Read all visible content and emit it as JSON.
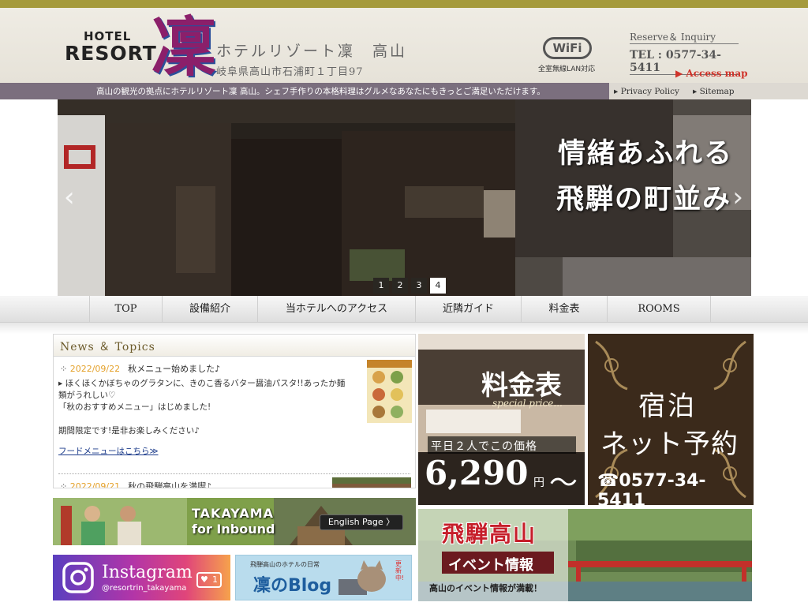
{
  "header": {
    "logo_hotel": "HOTEL",
    "logo_resort": "RESORT",
    "logo_kanji": "凜",
    "hotel_name": "ホテルリゾート凜　高山",
    "address": "岐阜県高山市石浦町１丁目97",
    "wifi_logo": "WiFi",
    "wifi_label": "全室無線LAN対応",
    "reserve_title": "Reserve＆ Inquiry",
    "tel": "TEL : 0577-34-5411",
    "access": "Access map"
  },
  "tagline": {
    "text": "高山の観光の拠点にホテルリゾート凜 高山。シェフ手作りの本格料理はグルメなあなたにもきっとご満足いただけます。",
    "privacy": "Privacy Policy",
    "sitemap": "Sitemap"
  },
  "hero": {
    "line1": "情緒あふれる",
    "line2": "飛騨の町並み",
    "prev_icon": "chevron-left-icon",
    "next_icon": "chevron-right-icon",
    "slides": [
      "1",
      "2",
      "3",
      "4"
    ],
    "active_slide": 4
  },
  "nav": {
    "items": [
      "TOP",
      "設備紹介",
      "当ホテルへのアクセス",
      "近隣ガイド",
      "料金表",
      "ROOMS"
    ]
  },
  "news": {
    "title": "News ＆ Topics",
    "items": [
      {
        "date": "2022/09/22",
        "headline": "秋メニュー始めました♪",
        "lines": [
          "▸ ほくほくかぼちゃのグラタンに、きのこ香るバター醤油パスタ!!あったか麺",
          "類がうれしい♡",
          "「秋のおすすめメニュー」はじめました!",
          "",
          "期間限定です!是非お楽しみください♪"
        ],
        "link": "フードメニューはこちら≫"
      },
      {
        "date": "2022/09/21",
        "headline": "秋の飛騨高山を満喫♪"
      }
    ]
  },
  "banners": {
    "inbound_line1": "TAKAYAMA",
    "inbound_line2": "for Inbound",
    "english_button": "English Page 〉",
    "instagram_name": "Instagram",
    "instagram_handle": "@resortrin_takayama",
    "instagram_count": "1",
    "blog_sub": "飛騨高山のホテルの日常",
    "blog_main": "凜のBlog",
    "blog_tag": "更新中!",
    "price_title": "料金表",
    "price_sub": "special price...",
    "price_note": "平日２人でこの価格",
    "price_value": "6,290",
    "price_unit": "円",
    "price_tilde": "〜",
    "reserve_line1": "宿泊",
    "reserve_line2": "ネット予約",
    "reserve_tel": "☎0577-34-5411",
    "event_title": "飛騨高山",
    "event_sub": "イベント情報",
    "event_note": "高山のイベント情報が満載！"
  },
  "colors": {
    "brand_purple": "#8b1f6a",
    "accent_gold": "#a59a3c",
    "tagbar": "#7b6f7e",
    "access_red": "#d0332a",
    "news_date": "#e4a12a"
  }
}
